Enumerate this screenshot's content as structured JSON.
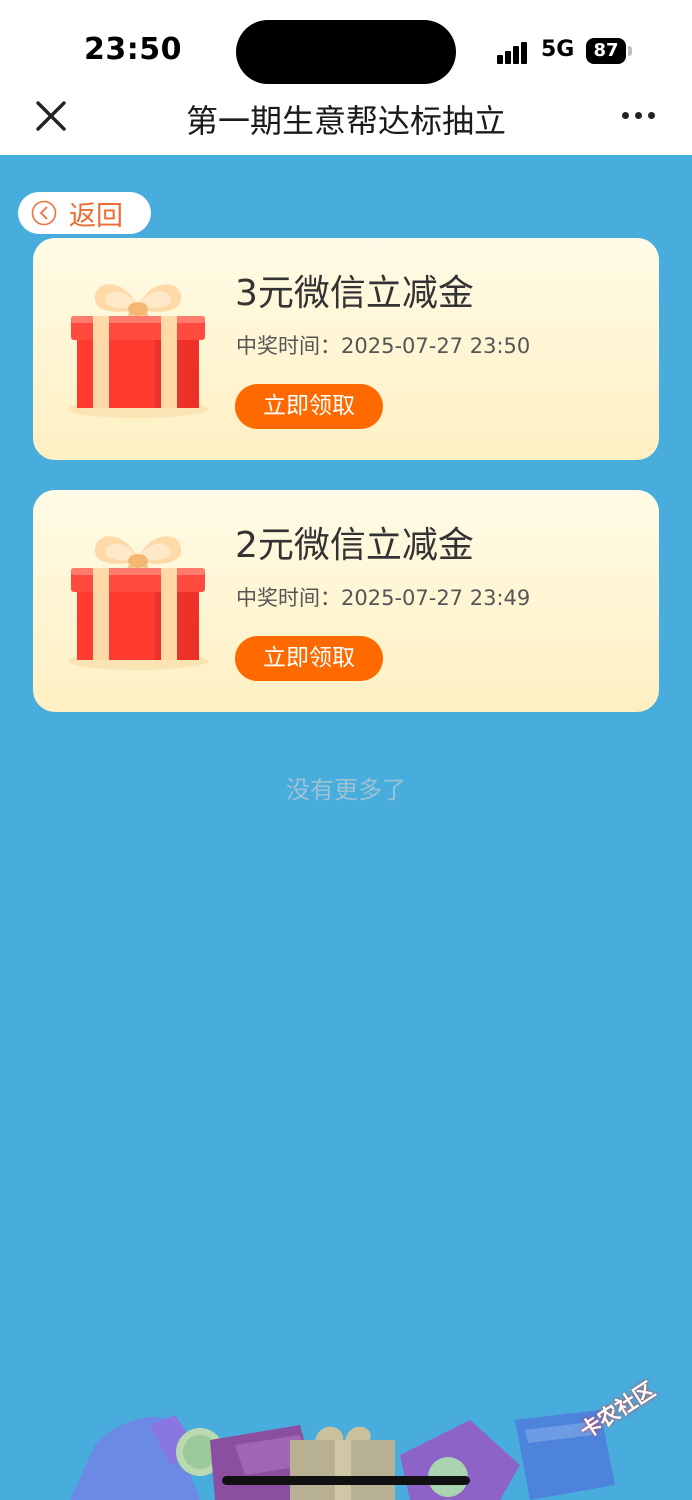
{
  "status_bar": {
    "time": "23:50",
    "network": "5G",
    "battery": "87"
  },
  "nav": {
    "title": "第一期生意帮达标抽立"
  },
  "back_button": {
    "label": "返回"
  },
  "prizes": [
    {
      "name": "3元微信立减金",
      "time": "中奖时间：2025-07-27 23:50",
      "button": "立即领取"
    },
    {
      "name": "2元微信立减金",
      "time": "中奖时间：2025-07-27 23:49",
      "button": "立即领取"
    }
  ],
  "footer": {
    "no_more": "没有更多了"
  },
  "watermark": "卡农社区",
  "colors": {
    "background": "#48addc",
    "card": "#fff4d4",
    "accent": "#fe6a00",
    "back_text": "#ee6a33"
  }
}
